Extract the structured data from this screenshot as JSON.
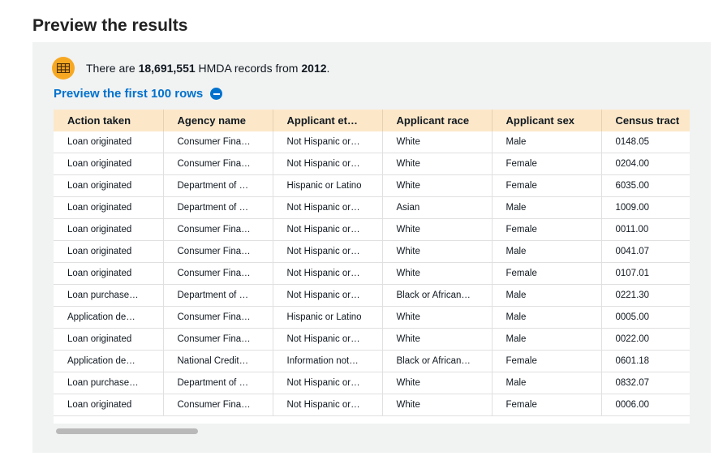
{
  "page": {
    "title": "Preview the results"
  },
  "summary": {
    "prefix": "There are ",
    "count": "18,691,551",
    "middle": " HMDA records from ",
    "year": "2012",
    "suffix": "."
  },
  "preview_link": {
    "label": "Preview the first 100 rows"
  },
  "table": {
    "columns": [
      "Action taken",
      "Agency name",
      "Applicant et…",
      "Applicant race",
      "Applicant sex",
      "Census tract"
    ],
    "rows": [
      [
        "Loan originated",
        "Consumer Fina…",
        "Not Hispanic or…",
        "White",
        "Male",
        "0148.05"
      ],
      [
        "Loan originated",
        "Consumer Fina…",
        "Not Hispanic or…",
        "White",
        "Female",
        "0204.00"
      ],
      [
        "Loan originated",
        "Department of …",
        "Hispanic or Latino",
        "White",
        "Female",
        "6035.00"
      ],
      [
        "Loan originated",
        "Department of …",
        "Not Hispanic or…",
        "Asian",
        "Male",
        "1009.00"
      ],
      [
        "Loan originated",
        "Consumer Fina…",
        "Not Hispanic or…",
        "White",
        "Female",
        "0011.00"
      ],
      [
        "Loan originated",
        "Consumer Fina…",
        "Not Hispanic or…",
        "White",
        "Male",
        "0041.07"
      ],
      [
        "Loan originated",
        "Consumer Fina…",
        "Not Hispanic or…",
        "White",
        "Female",
        "0107.01"
      ],
      [
        "Loan purchase…",
        "Department of …",
        "Not Hispanic or…",
        "Black or African…",
        "Male",
        "0221.30"
      ],
      [
        "Application de…",
        "Consumer Fina…",
        "Hispanic or Latino",
        "White",
        "Male",
        "0005.00"
      ],
      [
        "Loan originated",
        "Consumer Fina…",
        "Not Hispanic or…",
        "White",
        "Male",
        "0022.00"
      ],
      [
        "Application de…",
        "National Credit…",
        "Information not…",
        "Black or African…",
        "Female",
        "0601.18"
      ],
      [
        "Loan purchase…",
        "Department of …",
        "Not Hispanic or…",
        "White",
        "Male",
        "0832.07"
      ],
      [
        "Loan originated",
        "Consumer Fina…",
        "Not Hispanic or…",
        "White",
        "Female",
        "0006.00"
      ]
    ]
  },
  "icons": {
    "summary": "table-icon",
    "toggle": "minus-circle-icon"
  },
  "colors": {
    "accent": "#0072ce",
    "header_bg": "#fce8c9",
    "icon_bg": "#f7a823"
  }
}
